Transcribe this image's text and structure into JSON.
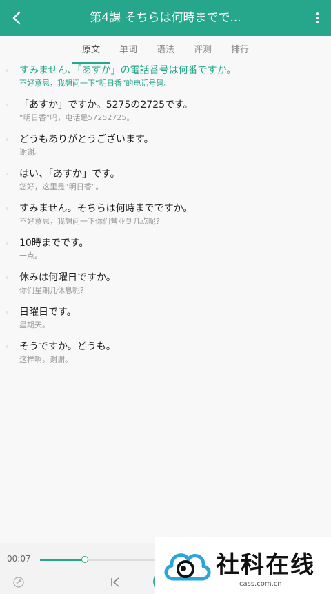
{
  "header": {
    "title": "第4課 そちらは何時までで..."
  },
  "tabs": [
    {
      "label": "原文",
      "active": true
    },
    {
      "label": "单词",
      "active": false
    },
    {
      "label": "语法",
      "active": false
    },
    {
      "label": "评测",
      "active": false
    },
    {
      "label": "排行",
      "active": false
    }
  ],
  "lines": [
    {
      "jp": "すみません、「あすか」の電話番号は何番ですか。",
      "cn": "不好意思，我想问一下“明日香”的电话号码。",
      "active": true
    },
    {
      "jp": "「あすか」ですか。5275の2725です。",
      "cn": "“明日香”吗，电话是57252725。",
      "active": false
    },
    {
      "jp": "どうもありがとうございます。",
      "cn": "谢谢。",
      "active": false
    },
    {
      "jp": "はい、「あすか」です。",
      "cn": "您好，这里是“明日香”。",
      "active": false
    },
    {
      "jp": "すみません。そちらは何時までですか。",
      "cn": "不好意思，我想问一下你们营业到几点呢?",
      "active": false
    },
    {
      "jp": "10時までです。",
      "cn": "十点。",
      "active": false
    },
    {
      "jp": "休みは何曜日ですか。",
      "cn": "你们星期几休息呢?",
      "active": false
    },
    {
      "jp": "日曜日です。",
      "cn": "星期天。",
      "active": false
    },
    {
      "jp": "そうですか。どうも。",
      "cn": "这样啊，谢谢。",
      "active": false
    }
  ],
  "player": {
    "current_time": "00:07",
    "progress": 0.36
  },
  "watermark": {
    "text": "社科在线",
    "url": "cass.com.cn"
  },
  "colors": {
    "accent": "#26a68a"
  }
}
